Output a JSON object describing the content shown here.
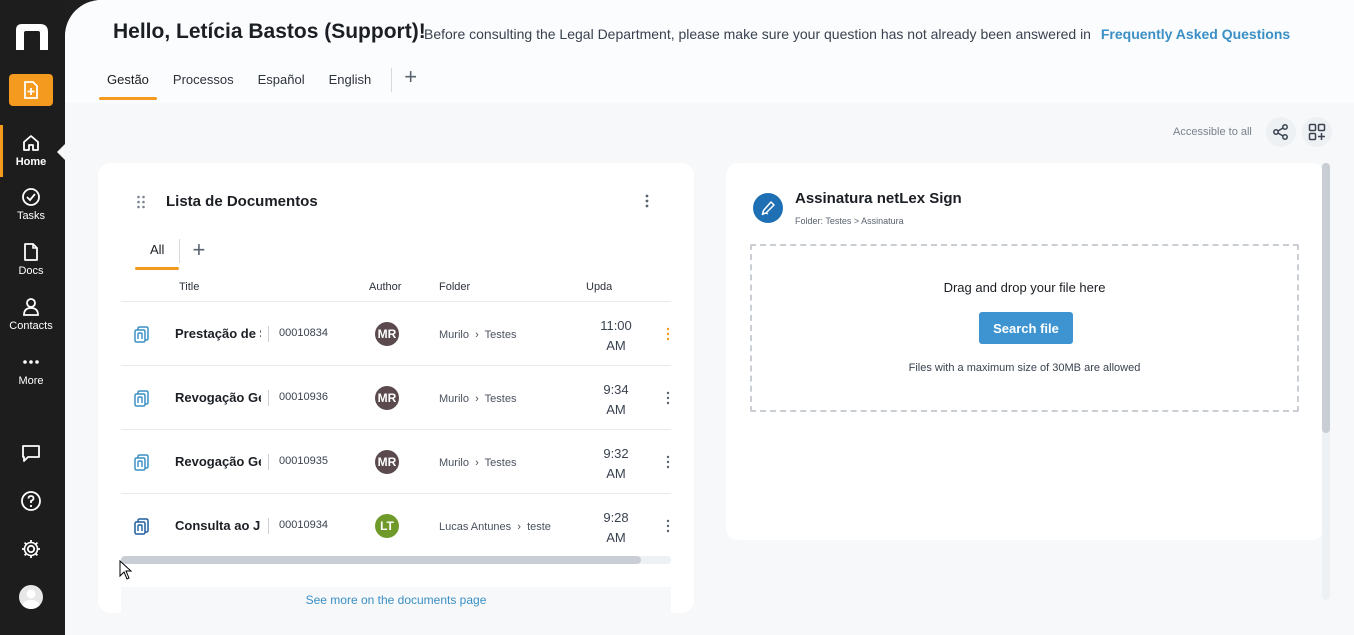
{
  "sidebar": {
    "nav": [
      {
        "label": "Home",
        "icon": "home-icon"
      },
      {
        "label": "Tasks",
        "icon": "check-circle-icon"
      },
      {
        "label": "Docs",
        "icon": "document-icon"
      },
      {
        "label": "Contacts",
        "icon": "person-icon"
      },
      {
        "label": "More",
        "icon": "dots-icon"
      }
    ],
    "accent": "#f39a1f"
  },
  "header": {
    "greeting": "Hello, Letícia Bastos (Support)!",
    "notice": "Before consulting the Legal Department, please make sure your question has not already been answered in",
    "faq_link": "Frequently Asked Questions",
    "tabs": [
      "Gestão",
      "Processos",
      "Español",
      "English"
    ],
    "active_tab": "Gestão",
    "add_tab": "+"
  },
  "toolbar": {
    "accessible_label": "Accessible to all"
  },
  "documents": {
    "title": "Lista de Documentos",
    "tabs": [
      "All"
    ],
    "add_tab": "+",
    "columns": [
      "Title",
      "Author",
      "Folder",
      "Upda"
    ],
    "rows": [
      {
        "title": "Prestação de S",
        "number": "00010834",
        "author": "MR",
        "author_color": "#5a4a4e",
        "folder_a": "Murilo",
        "folder_b": "Testes",
        "time_1": "11:00",
        "time_2": "AM",
        "icon_color": "#3a8fc5"
      },
      {
        "title": "Revogação Ger",
        "number": "00010936",
        "author": "MR",
        "author_color": "#5a4a4e",
        "folder_a": "Murilo",
        "folder_b": "Testes",
        "time_1": "9:34",
        "time_2": "AM",
        "icon_color": "#3a8fc5"
      },
      {
        "title": "Revogação Ger",
        "number": "00010935",
        "author": "MR",
        "author_color": "#5a4a4e",
        "folder_a": "Murilo",
        "folder_b": "Testes",
        "time_1": "9:32",
        "time_2": "AM",
        "icon_color": "#3a8fc5"
      },
      {
        "title": "Consulta ao Ju",
        "number": "00010934",
        "author": "LT",
        "author_color": "#6f9a2a",
        "folder_a": "Lucas Antunes",
        "folder_b": "teste",
        "time_1": "9:28",
        "time_2": "AM",
        "icon_color": "#1f5fa0"
      }
    ],
    "see_more": "See more on the documents page"
  },
  "sign": {
    "title": "Assinatura netLex Sign",
    "subtitle": "Folder: Testes > Assinatura",
    "drop_text": "Drag and drop your file here",
    "button": "Search file",
    "note": "Files with a maximum size of 30MB are allowed"
  }
}
